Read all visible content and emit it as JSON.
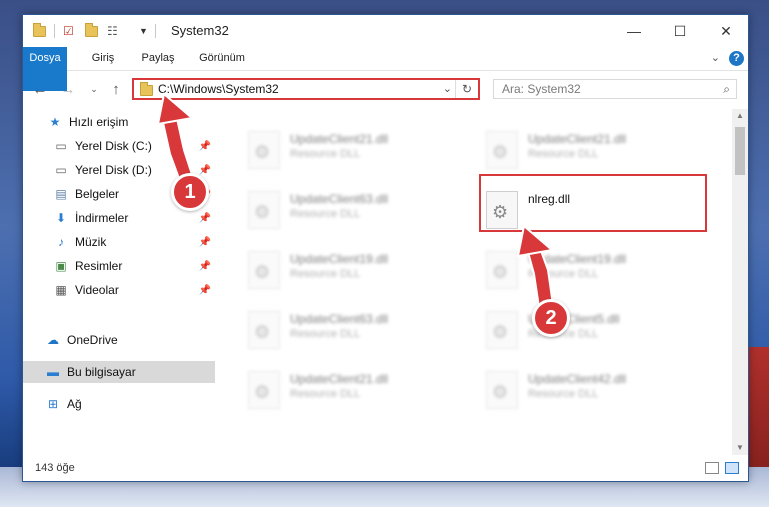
{
  "window": {
    "title": "System32",
    "controls": {
      "minimize": "—",
      "maximize": "☐",
      "close": "✕"
    }
  },
  "ribbon": {
    "tabs": [
      {
        "label": "Dosya",
        "active": true
      },
      {
        "label": "Giriş"
      },
      {
        "label": "Paylaş"
      },
      {
        "label": "Görünüm"
      }
    ],
    "help": "?"
  },
  "navigation": {
    "address": "C:\\Windows\\System32",
    "search_placeholder": "Ara: System32"
  },
  "sidebar": {
    "items": [
      {
        "label": "Hızlı erişim",
        "icon": "star-icon",
        "pinned": false
      },
      {
        "label": "Yerel Disk (C:)",
        "icon": "drive-icon",
        "pinned": true
      },
      {
        "label": "Yerel Disk (D:)",
        "icon": "drive-icon",
        "pinned": true
      },
      {
        "label": "Belgeler",
        "icon": "document-icon",
        "pinned": true
      },
      {
        "label": "İndirmeler",
        "icon": "download-icon",
        "pinned": true
      },
      {
        "label": "Müzik",
        "icon": "music-icon",
        "pinned": true
      },
      {
        "label": "Resimler",
        "icon": "image-icon",
        "pinned": true
      },
      {
        "label": "Videolar",
        "icon": "video-icon",
        "pinned": true
      },
      {
        "label": "OneDrive",
        "icon": "cloud-icon",
        "pinned": false
      },
      {
        "label": "Bu bilgisayar",
        "icon": "computer-icon",
        "pinned": false,
        "selected": true
      },
      {
        "label": "Ağ",
        "icon": "network-icon",
        "pinned": false
      }
    ]
  },
  "files": [
    {
      "name": "UpdateClient21.dll",
      "type": "Resource DLL",
      "blurred": true
    },
    {
      "name": "UpdateClient21.dll",
      "type": "Resource DLL",
      "blurred": true
    },
    {
      "name": "UpdateClient63.dll",
      "type": "Resource DLL",
      "blurred": true
    },
    {
      "name": "nlreg.dll",
      "type": "",
      "blurred": false,
      "highlighted": true
    },
    {
      "name": "UpdateClient19.dll",
      "type": "Resource DLL",
      "blurred": true
    },
    {
      "name": "UpdateClient19.dll",
      "type": "Resource DLL",
      "blurred": true
    },
    {
      "name": "UpdateClient63.dll",
      "type": "Resource DLL",
      "blurred": true
    },
    {
      "name": "UpdateClient5.dll",
      "type": "Resource DLL",
      "blurred": true
    },
    {
      "name": "UpdateClient21.dll",
      "type": "Resource DLL",
      "blurred": true
    },
    {
      "name": "UpdateClient42.dll",
      "type": "Resource DLL",
      "blurred": true
    }
  ],
  "status": {
    "count": "143 öğe"
  },
  "markers": [
    {
      "label": "1"
    },
    {
      "label": "2"
    }
  ],
  "colors": {
    "accent": "#1979ca",
    "highlight": "#d9383a",
    "selected_bg": "#d9d9d9"
  }
}
